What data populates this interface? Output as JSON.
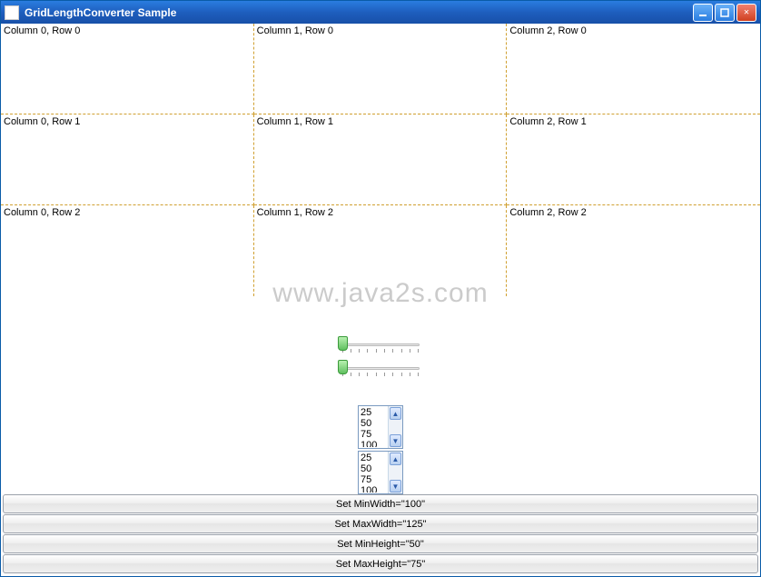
{
  "window": {
    "title": "GridLengthConverter Sample"
  },
  "grid": {
    "cells": [
      "Column 0, Row 0",
      "Column 1, Row 0",
      "Column 2, Row 0",
      "Column 0, Row 1",
      "Column 1, Row 1",
      "Column 2, Row 1",
      "Column 0, Row 2",
      "Column 1, Row 2",
      "Column 2, Row 2"
    ]
  },
  "watermark": "www.java2s.com",
  "listbox1": {
    "items": [
      "25",
      "50",
      "75",
      "100"
    ]
  },
  "listbox2": {
    "items": [
      "25",
      "50",
      "75",
      "100"
    ]
  },
  "buttons": {
    "setMinWidth": "Set MinWidth=\"100\"",
    "setMaxWidth": "Set MaxWidth=\"125\"",
    "setMinHeight": "Set MinHeight=\"50\"",
    "setMaxHeight": "Set MaxHeight=\"75\""
  }
}
